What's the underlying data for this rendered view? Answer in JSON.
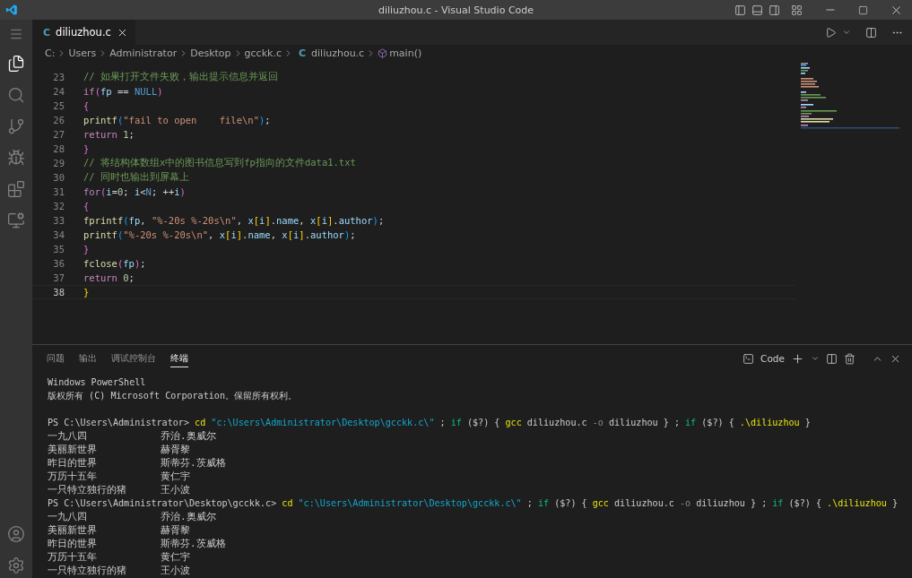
{
  "window": {
    "title": "diliuzhou.c - Visual Studio Code"
  },
  "editor_tabs": [
    {
      "label": "diliuzhou.c",
      "file_icon": "C",
      "selected": true
    }
  ],
  "breadcrumb": [
    {
      "text": "C:"
    },
    {
      "text": "Users"
    },
    {
      "text": "Administrator"
    },
    {
      "text": "Desktop"
    },
    {
      "text": "gcckk.c"
    },
    {
      "text": "diliuzhou.c",
      "kind": "file",
      "file_icon": "C"
    },
    {
      "text": "main()",
      "kind": "symbol"
    }
  ],
  "code_lines": [
    {
      "number": "23",
      "current": false,
      "tokens": [
        {
          "text": "// 如果打开文件失败，输出提示信息并返回",
          "kind": "cmt"
        }
      ]
    },
    {
      "number": "24",
      "current": false,
      "tokens": [
        {
          "text": "if",
          "kind": "kw"
        },
        {
          "text": "(",
          "kind": "b2"
        },
        {
          "text": "fp",
          "kind": "var"
        },
        {
          "text": " == ",
          "kind": "punc"
        },
        {
          "text": "NULL",
          "kind": "const"
        },
        {
          "text": ")",
          "kind": "b2"
        }
      ]
    },
    {
      "number": "25",
      "current": false,
      "tokens": [
        {
          "text": "{",
          "kind": "b2"
        }
      ]
    },
    {
      "number": "26",
      "current": false,
      "tokens": [
        {
          "text": "printf",
          "kind": "fn"
        },
        {
          "text": "(",
          "kind": "b3"
        },
        {
          "text": "\"fail to open    file\\n\"",
          "kind": "str"
        },
        {
          "text": ")",
          "kind": "b3"
        },
        {
          "text": ";",
          "kind": "punc"
        }
      ]
    },
    {
      "number": "27",
      "current": false,
      "tokens": [
        {
          "text": "return ",
          "kind": "kw"
        },
        {
          "text": "1",
          "kind": "num"
        },
        {
          "text": ";",
          "kind": "punc"
        }
      ]
    },
    {
      "number": "28",
      "current": false,
      "tokens": [
        {
          "text": "}",
          "kind": "b2"
        }
      ]
    },
    {
      "number": "29",
      "current": false,
      "tokens": [
        {
          "text": "// 将结构体数组x中的图书信息写到fp指向的文件data1.txt",
          "kind": "cmt"
        }
      ]
    },
    {
      "number": "30",
      "current": false,
      "tokens": [
        {
          "text": "// 同时也输出到屏幕上",
          "kind": "cmt"
        }
      ]
    },
    {
      "number": "31",
      "current": false,
      "tokens": [
        {
          "text": "for",
          "kind": "kw"
        },
        {
          "text": "(",
          "kind": "b2"
        },
        {
          "text": "i",
          "kind": "var"
        },
        {
          "text": "=",
          "kind": "punc"
        },
        {
          "text": "0",
          "kind": "num"
        },
        {
          "text": "; ",
          "kind": "punc"
        },
        {
          "text": "i",
          "kind": "var"
        },
        {
          "text": "<",
          "kind": "punc"
        },
        {
          "text": "N",
          "kind": "const"
        },
        {
          "text": "; ++",
          "kind": "punc"
        },
        {
          "text": "i",
          "kind": "var"
        },
        {
          "text": ")",
          "kind": "b2"
        }
      ]
    },
    {
      "number": "32",
      "current": false,
      "tokens": [
        {
          "text": "{",
          "kind": "b2"
        }
      ]
    },
    {
      "number": "33",
      "current": false,
      "tokens": [
        {
          "text": "fprintf",
          "kind": "fn"
        },
        {
          "text": "(",
          "kind": "b3"
        },
        {
          "text": "fp",
          "kind": "var"
        },
        {
          "text": ", ",
          "kind": "punc"
        },
        {
          "text": "\"%-20s %-20s\\n\"",
          "kind": "str"
        },
        {
          "text": ", ",
          "kind": "punc"
        },
        {
          "text": "x",
          "kind": "var"
        },
        {
          "text": "[",
          "kind": "b1"
        },
        {
          "text": "i",
          "kind": "var"
        },
        {
          "text": "]",
          "kind": "b1"
        },
        {
          "text": ".",
          "kind": "punc"
        },
        {
          "text": "name",
          "kind": "var"
        },
        {
          "text": ", ",
          "kind": "punc"
        },
        {
          "text": "x",
          "kind": "var"
        },
        {
          "text": "[",
          "kind": "b1"
        },
        {
          "text": "i",
          "kind": "var"
        },
        {
          "text": "]",
          "kind": "b1"
        },
        {
          "text": ".",
          "kind": "punc"
        },
        {
          "text": "author",
          "kind": "var"
        },
        {
          "text": ")",
          "kind": "b3"
        },
        {
          "text": ";",
          "kind": "punc"
        }
      ]
    },
    {
      "number": "34",
      "current": false,
      "tokens": [
        {
          "text": "printf",
          "kind": "fn"
        },
        {
          "text": "(",
          "kind": "b3"
        },
        {
          "text": "\"%-20s %-20s\\n\"",
          "kind": "str"
        },
        {
          "text": ", ",
          "kind": "punc"
        },
        {
          "text": "x",
          "kind": "var"
        },
        {
          "text": "[",
          "kind": "b1"
        },
        {
          "text": "i",
          "kind": "var"
        },
        {
          "text": "]",
          "kind": "b1"
        },
        {
          "text": ".",
          "kind": "punc"
        },
        {
          "text": "name",
          "kind": "var"
        },
        {
          "text": ", ",
          "kind": "punc"
        },
        {
          "text": "x",
          "kind": "var"
        },
        {
          "text": "[",
          "kind": "b1"
        },
        {
          "text": "i",
          "kind": "var"
        },
        {
          "text": "]",
          "kind": "b1"
        },
        {
          "text": ".",
          "kind": "punc"
        },
        {
          "text": "author",
          "kind": "var"
        },
        {
          "text": ")",
          "kind": "b3"
        },
        {
          "text": ";",
          "kind": "punc"
        }
      ]
    },
    {
      "number": "35",
      "current": false,
      "tokens": [
        {
          "text": "}",
          "kind": "b2"
        }
      ]
    },
    {
      "number": "36",
      "current": false,
      "tokens": [
        {
          "text": "fclose",
          "kind": "fn"
        },
        {
          "text": "(",
          "kind": "b2"
        },
        {
          "text": "fp",
          "kind": "var"
        },
        {
          "text": ")",
          "kind": "b2"
        },
        {
          "text": ";",
          "kind": "punc"
        }
      ]
    },
    {
      "number": "37",
      "current": false,
      "tokens": [
        {
          "text": "return ",
          "kind": "kw"
        },
        {
          "text": "0",
          "kind": "num"
        },
        {
          "text": ";",
          "kind": "punc"
        }
      ]
    },
    {
      "number": "38",
      "current": true,
      "tokens": [
        {
          "text": "}",
          "kind": "b1"
        }
      ]
    }
  ],
  "panel_tabs": [
    {
      "label": "问题",
      "selected": false
    },
    {
      "label": "输出",
      "selected": false
    },
    {
      "label": "调试控制台",
      "selected": false
    },
    {
      "label": "终端",
      "selected": true
    }
  ],
  "terminal_name": "Code",
  "terminal_lines": [
    {
      "kind": "text",
      "text": "Windows PowerShell"
    },
    {
      "kind": "text",
      "text": "版权所有 (C) Microsoft Corporation。保留所有权利。"
    },
    {
      "kind": "blank"
    },
    {
      "kind": "command",
      "tokens": [
        {
          "text": "PS C:\\Users\\Administrator> ",
          "kind": "plain"
        },
        {
          "text": "cd ",
          "kind": "cmd"
        },
        {
          "text": "\"c:\\Users\\Administrator\\Desktop\\gcckk.c\\\"",
          "kind": "path"
        },
        {
          "text": " ; ",
          "kind": "plain"
        },
        {
          "text": "if",
          "kind": "kw"
        },
        {
          "text": " ($?) { ",
          "kind": "plain"
        },
        {
          "text": "gcc",
          "kind": "cmd"
        },
        {
          "text": " diliuzhou.c ",
          "kind": "plain"
        },
        {
          "text": "-o",
          "kind": "flag"
        },
        {
          "text": " diliuzhou } ; ",
          "kind": "plain"
        },
        {
          "text": "if",
          "kind": "kw"
        },
        {
          "text": " ($?) { ",
          "kind": "plain"
        },
        {
          "text": ".\\diliuzhou",
          "kind": "cmd"
        },
        {
          "text": " }",
          "kind": "plain"
        }
      ]
    },
    {
      "kind": "row",
      "title": "一九八四",
      "author": "乔治.奥威尔"
    },
    {
      "kind": "row",
      "title": "美丽新世界",
      "author": "赫胥黎"
    },
    {
      "kind": "row",
      "title": "昨日的世界",
      "author": "斯蒂芬.茨威格"
    },
    {
      "kind": "row",
      "title": "万历十五年",
      "author": "黄仁宇"
    },
    {
      "kind": "row",
      "title": "一只特立独行的猪",
      "author": "王小波"
    },
    {
      "kind": "command",
      "tokens": [
        {
          "text": "PS C:\\Users\\Administrator\\Desktop\\gcckk.c> ",
          "kind": "plain"
        },
        {
          "text": "cd ",
          "kind": "cmd"
        },
        {
          "text": "\"c:\\Users\\Administrator\\Desktop\\gcckk.c\\\"",
          "kind": "path"
        },
        {
          "text": " ; ",
          "kind": "plain"
        },
        {
          "text": "if",
          "kind": "kw"
        },
        {
          "text": " ($?) { ",
          "kind": "plain"
        },
        {
          "text": "gcc",
          "kind": "cmd"
        },
        {
          "text": " diliuzhou.c ",
          "kind": "plain"
        },
        {
          "text": "-o",
          "kind": "flag"
        },
        {
          "text": " diliuzhou } ; ",
          "kind": "plain"
        },
        {
          "text": "if",
          "kind": "kw"
        },
        {
          "text": " ($?) { ",
          "kind": "plain"
        },
        {
          "text": ".\\diliuzhou",
          "kind": "cmd"
        },
        {
          "text": " }",
          "kind": "plain"
        }
      ]
    },
    {
      "kind": "row",
      "title": "一九八四",
      "author": "乔治.奥威尔"
    },
    {
      "kind": "row",
      "title": "美丽新世界",
      "author": "赫胥黎"
    },
    {
      "kind": "row",
      "title": "昨日的世界",
      "author": "斯蒂芬.茨威格"
    },
    {
      "kind": "row",
      "title": "万历十五年",
      "author": "黄仁宇"
    },
    {
      "kind": "row",
      "title": "一只特立独行的猪",
      "author": "王小波"
    }
  ]
}
